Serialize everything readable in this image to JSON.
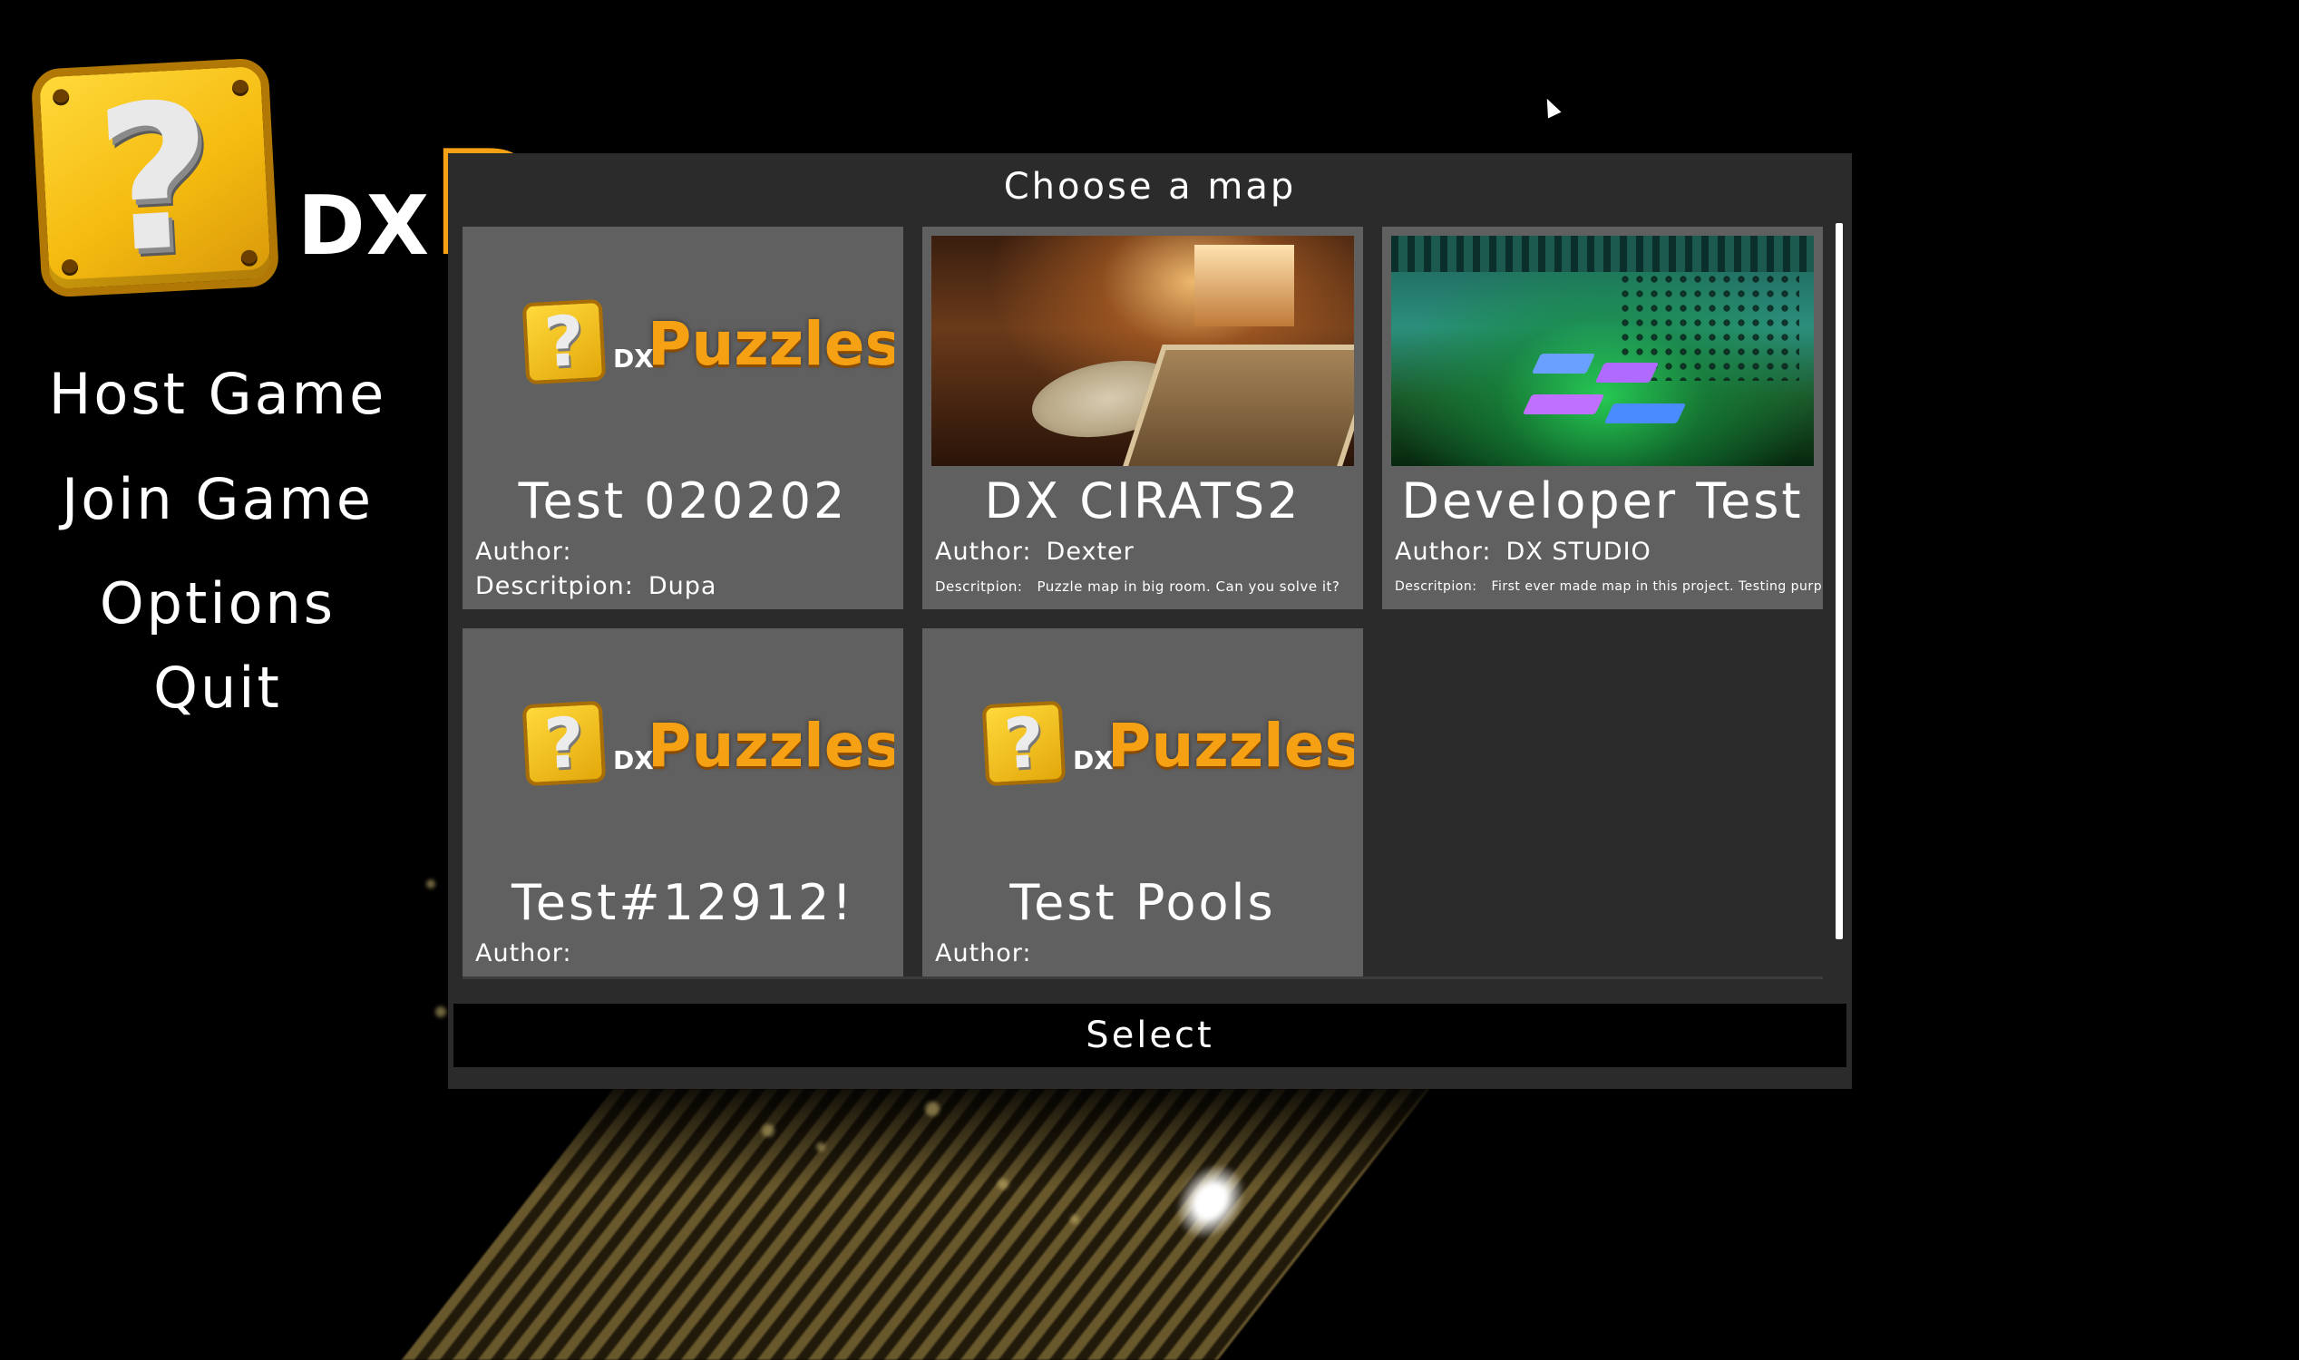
{
  "logo": {
    "icon": "question-block-icon",
    "glyph": "?",
    "dx": "DX",
    "word_visible": "P"
  },
  "menu": [
    {
      "label": "Host Game"
    },
    {
      "label": "Join Game"
    },
    {
      "label": "Options"
    },
    {
      "label": "Quit"
    }
  ],
  "dialog": {
    "title": "Choose a map",
    "select_label": "Select",
    "author_label": "Author:",
    "desc_label": "Descritpion:"
  },
  "mini_logo": {
    "glyph": "?",
    "dx": "DX",
    "word": "Puzzles"
  },
  "maps": [
    {
      "title": "Test 020202",
      "author": "",
      "description": "Dupa",
      "thumbnail": "logo"
    },
    {
      "title": "DX CIRATS2",
      "author": "Dexter",
      "description": "Puzzle map in big room. Can you solve it?",
      "thumbnail": "room-screenshot"
    },
    {
      "title": "Developer Test",
      "author": "DX STUDIO",
      "description": "First ever made map in this project. Testing purposes",
      "thumbnail": "lab-screenshot"
    },
    {
      "title": "Test#12912!",
      "author": "",
      "description": "",
      "thumbnail": "logo"
    },
    {
      "title": "Test Pools",
      "author": "",
      "description": "",
      "thumbnail": "logo"
    }
  ],
  "colors": {
    "dialog_bg": "#2b2b2b",
    "card_bg": "#606060",
    "logo_orange": "#f6a114",
    "logo_yellow": "#ffd93a"
  }
}
